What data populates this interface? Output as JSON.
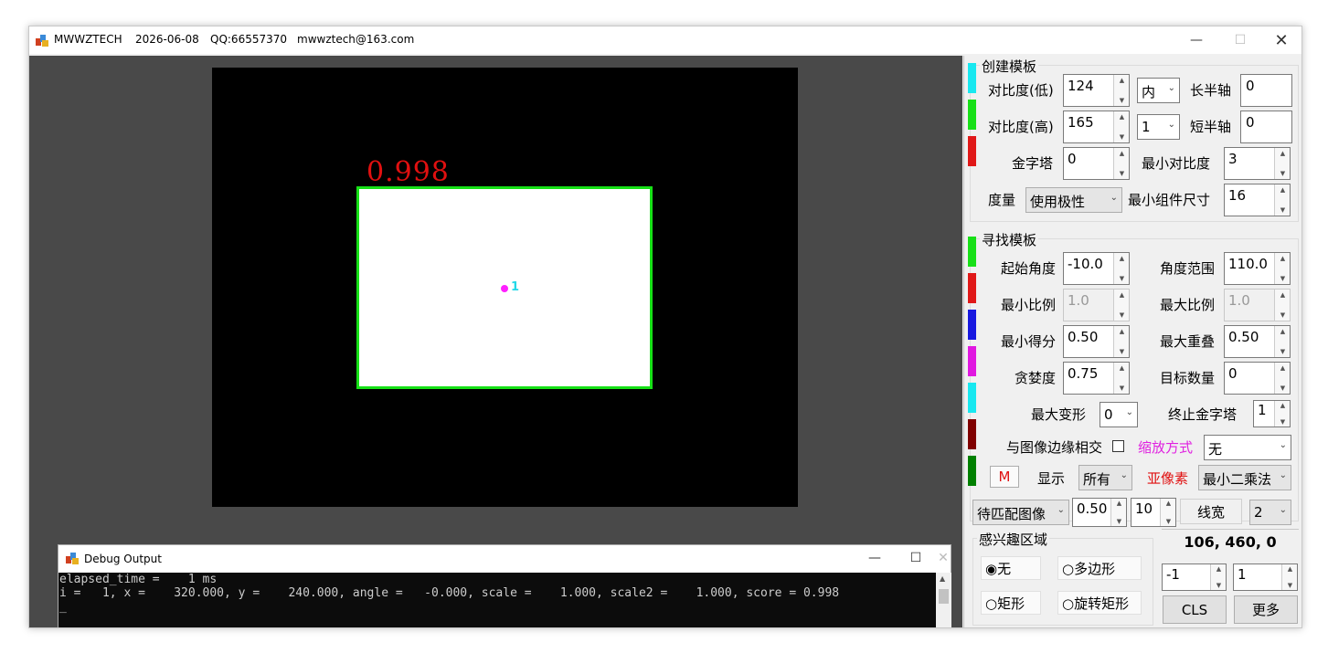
{
  "window": {
    "app_name": "MWWZTECH",
    "date": "2026-06-08",
    "qq": "QQ:66557370",
    "email": "mwwztech@163.com"
  },
  "canvas": {
    "score_label": "0.998",
    "match_id": "1"
  },
  "debug": {
    "title": "Debug Output",
    "lines": [
      "elapsed_time =    1 ms",
      "i =   1, x =    320.000, y =    240.000, angle =   -0.000, scale =    1.000, scale2 =    1.000, score = 0.998",
      "_"
    ]
  },
  "create": {
    "title": "创建模板",
    "contrast_low_label": "对比度(低)",
    "contrast_low": "124",
    "contrast_high_label": "对比度(高)",
    "contrast_high": "165",
    "pyramid_label": "金字塔",
    "pyramid": "0",
    "metric_label": "度量",
    "metric": "使用极性",
    "polarity": "内",
    "polarity2": "1",
    "major_axis_label": "长半轴",
    "major_axis": "0",
    "minor_axis_label": "短半轴",
    "minor_axis": "0",
    "min_contrast_label": "最小对比度",
    "min_contrast": "3",
    "min_comp_label": "最小组件尺寸",
    "min_comp": "16"
  },
  "find": {
    "title": "寻找模板",
    "start_angle_label": "起始角度",
    "start_angle": "-10.0",
    "angle_range_label": "角度范围",
    "angle_range": "110.0",
    "min_scale_label": "最小比例",
    "min_scale": "1.0",
    "max_scale_label": "最大比例",
    "max_scale": "1.0",
    "min_score_label": "最小得分",
    "min_score": "0.50",
    "max_overlap_label": "最大重叠",
    "max_overlap": "0.50",
    "greed_label": "贪婪度",
    "greed": "0.75",
    "num_targets_label": "目标数量",
    "num_targets": "0",
    "max_deform_label": "最大变形",
    "max_deform": "0",
    "stop_pyramid_label": "终止金字塔",
    "stop_pyramid": "1",
    "border_label": "与图像边缘相交",
    "scale_mode_label": "缩放方式",
    "scale_mode": "无",
    "m_button": "M",
    "display_label": "显示",
    "display": "所有",
    "subpixel_label": "亚像素",
    "subpixel": "最小二乘法"
  },
  "bottom": {
    "source": "待匹配图像",
    "val1": "0.50",
    "val2": "10",
    "line_width_label": "线宽",
    "line_width": "2",
    "roi_title": "感兴趣区域",
    "roi_none": "无",
    "roi_polygon": "多边形",
    "roi_rect": "矩形",
    "roi_rot_rect": "旋转矩形",
    "coords": "106, 460, 0",
    "spin_a": "-1",
    "spin_b": "1",
    "cls": "CLS",
    "more": "更多"
  },
  "colors": {
    "accent_red": "#e01010",
    "match_green": "#16e016",
    "magenta": "#e020e0"
  }
}
